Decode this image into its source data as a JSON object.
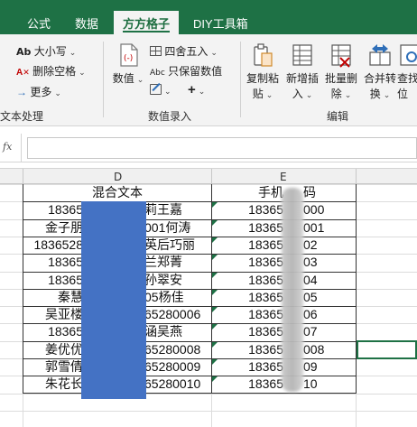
{
  "ribbon_tabs": [
    "公式",
    "数据",
    "方方格子",
    "DIY工具箱"
  ],
  "text_group": {
    "case_label": "大小写",
    "case_icon_text": "Ab",
    "remove_space_label": "删除空格",
    "more_label": "更多",
    "group_label": "文本处理"
  },
  "number_group": {
    "numeric_label": "数值",
    "round_label": "四舍五入",
    "keep_value_label": "只保留数值",
    "keep_value_icon_text": "Abc",
    "group_label": "数值录入"
  },
  "edit_group": {
    "buttons": [
      {
        "line1": "复制粘",
        "line2": "贴"
      },
      {
        "line1": "新增插",
        "line2": "入"
      },
      {
        "line1": "批量删",
        "line2": "除"
      },
      {
        "line1": "合并转",
        "line2": "换"
      },
      {
        "line1": "查找",
        "line2": "位"
      }
    ],
    "group_label": "编辑"
  },
  "formula_bar": {
    "fx_label": "fx",
    "value": ""
  },
  "columns": {
    "d": "D",
    "e": "E"
  },
  "table": {
    "header_d": "混合文本",
    "header_e_left": "手机",
    "header_e_right": "码",
    "rows": [
      {
        "d_left": "18365",
        "d_right": "莉王嘉",
        "e_left": "18365",
        "e_right": "000"
      },
      {
        "d_left": "金子朋",
        "d_right": "001何涛",
        "e_left": "18365",
        "e_right": "001"
      },
      {
        "d_left": "1836528",
        "d_right": "英后巧丽",
        "e_left": "18365",
        "e_right": "02"
      },
      {
        "d_left": "18365",
        "d_right": "兰郑菁",
        "e_left": "18365",
        "e_right": "03"
      },
      {
        "d_left": "18365",
        "d_right": "孙翠安",
        "e_left": "18365",
        "e_right": "04"
      },
      {
        "d_left": "秦慧",
        "d_right": "05杨佳",
        "e_left": "18365",
        "e_right": "05"
      },
      {
        "d_left": "吴亚楼",
        "d_right": "65280006",
        "e_left": "18365",
        "e_right": "06"
      },
      {
        "d_left": "18365",
        "d_right": "涵吴燕",
        "e_left": "18365",
        "e_right": "07"
      },
      {
        "d_left": "姜优优",
        "d_right": "65280008",
        "e_left": "18365",
        "e_right": "008"
      },
      {
        "d_left": "郭雪倩",
        "d_right": "65280009",
        "e_left": "18365",
        "e_right": "09"
      },
      {
        "d_left": "朱花长",
        "d_right": "65280010",
        "e_left": "18365",
        "e_right": "10"
      }
    ]
  },
  "colors": {
    "ribbon_green": "#1e7145",
    "redaction_blue": "#4472c4"
  }
}
